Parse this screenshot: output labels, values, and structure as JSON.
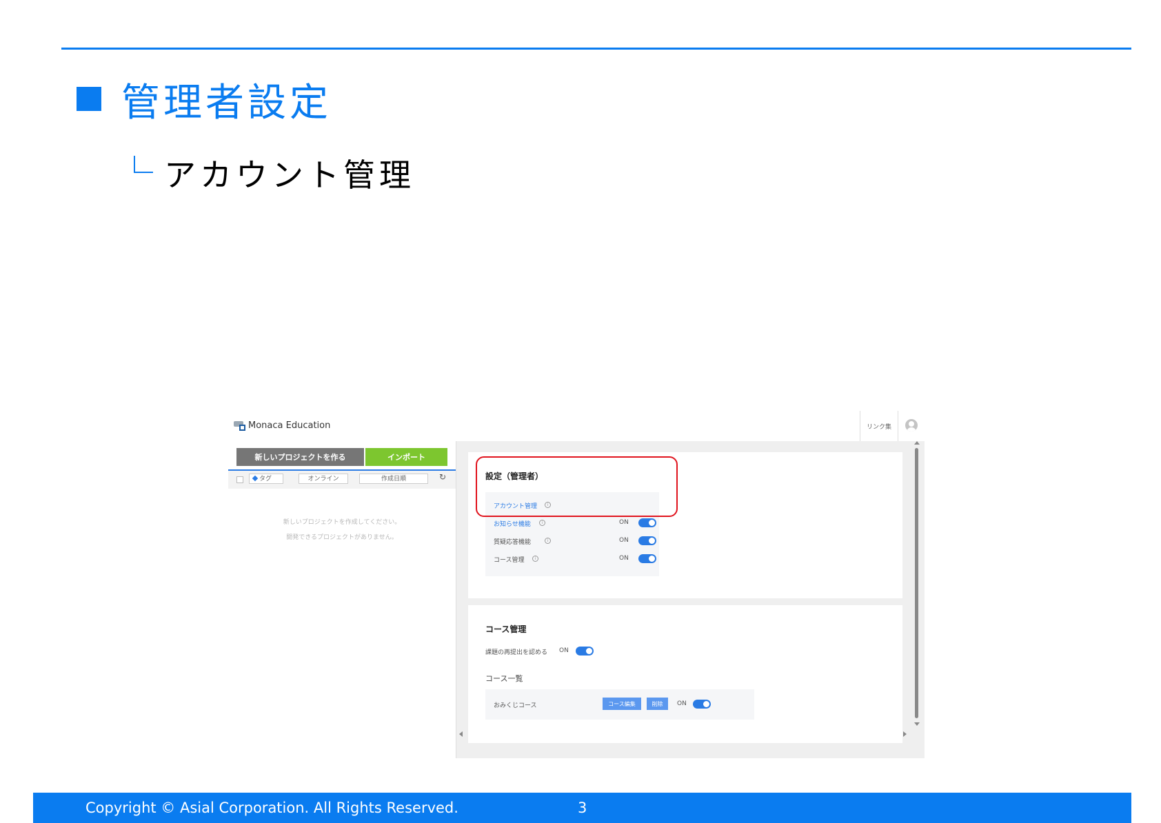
{
  "slide": {
    "title": "管理者設定",
    "subtitle": "アカウント管理"
  },
  "app": {
    "brand": "Monaca Education",
    "header_link": "リンク集",
    "buttons": {
      "new_project": "新しいプロジェクトを作る",
      "import": "インポート"
    },
    "filter": {
      "tag": "タグ",
      "online": "オンライン",
      "sort": "作成日順",
      "refresh_icon": "↻"
    },
    "empty": {
      "line1": "新しいプロジェクトを作成してください。",
      "line2": "開発できるプロジェクトがありません。"
    },
    "settings": {
      "title": "設定（管理者）",
      "rows": [
        {
          "label": "アカウント管理",
          "info": "i"
        },
        {
          "label": "お知らせ機能",
          "info": "i",
          "state": "ON"
        },
        {
          "label": "質疑応答機能",
          "info": "i",
          "state": "ON"
        },
        {
          "label": "コース管理",
          "info": "i",
          "state": "ON"
        }
      ]
    },
    "course": {
      "title": "コース管理",
      "resubmit_label": "課題の再提出を認める",
      "resubmit_state": "ON",
      "list_title": "コース一覧",
      "items": [
        {
          "name": "おみくじコース",
          "edit": "コース編集",
          "delete": "削除",
          "state": "ON"
        }
      ]
    }
  },
  "footer": {
    "copyright": "Copyright ©  Asial Corporation. All Rights Reserved.",
    "page": "3"
  },
  "colors": {
    "accent": "#0a7cf0",
    "highlight": "#e0121c",
    "import_green": "#7dc62f"
  }
}
